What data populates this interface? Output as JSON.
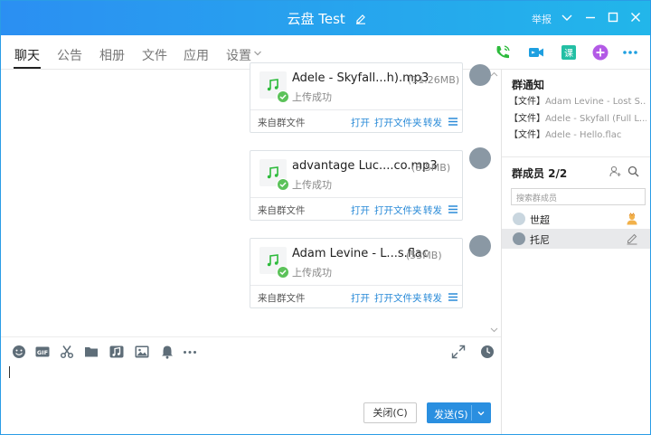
{
  "window": {
    "title": "云盘 Test",
    "report_label": "举报"
  },
  "tabs": [
    {
      "label": "聊天",
      "active": true
    },
    {
      "label": "公告"
    },
    {
      "label": "相册"
    },
    {
      "label": "文件"
    },
    {
      "label": "应用"
    },
    {
      "label": "设置"
    }
  ],
  "top_icons": [
    "phone-call-icon",
    "video-call-icon",
    "classroom-icon",
    "add-app-icon",
    "more-icon"
  ],
  "messages": [
    {
      "file_name": "Adele - Skyfall...h).mp3",
      "file_size": "(11.26MB)",
      "status": "上传成功",
      "source": "来自群文件",
      "actions": [
        "打开",
        "打开文件夹",
        "转发"
      ]
    },
    {
      "file_name": "advantage Luc....co.mp3",
      "file_size": "(8.5MB)",
      "status": "上传成功",
      "source": "来自群文件",
      "actions": [
        "打开",
        "打开文件夹",
        "转发"
      ]
    },
    {
      "file_name": "Adam Levine - L...s.flac",
      "file_size": "(53MB)",
      "status": "上传成功",
      "source": "来自群文件",
      "actions": [
        "打开",
        "打开文件夹",
        "转发"
      ]
    }
  ],
  "sidebar": {
    "notice_title": "群通知",
    "notices": [
      {
        "tag": "【文件】",
        "text": "Adam Levine - Lost S..."
      },
      {
        "tag": "【文件】",
        "text": "Adele - Skyfall (Full L..."
      },
      {
        "tag": "【文件】",
        "text": "Adele - Hello.flac"
      }
    ],
    "members_title": "群成员 2/2",
    "search_placeholder": "搜索群成员",
    "members": [
      {
        "name": "世超",
        "selected": false
      },
      {
        "name": "托尼",
        "selected": true
      }
    ]
  },
  "toolbar": {
    "icons": [
      "emoji-icon",
      "gif-icon",
      "scissors-icon",
      "folder-icon",
      "music-note-icon",
      "image-icon",
      "bell-icon",
      "more-dots-icon"
    ],
    "right_icons": [
      "expand-icon",
      "history-clock-icon"
    ]
  },
  "compose": {
    "close_label": "关闭(C)",
    "send_label": "发送(S)"
  },
  "colors": {
    "title_bar": "#2b8ff2",
    "accent": "#2a8fe0",
    "success": "#5cc25a",
    "music_green": "#2dbb3c"
  }
}
